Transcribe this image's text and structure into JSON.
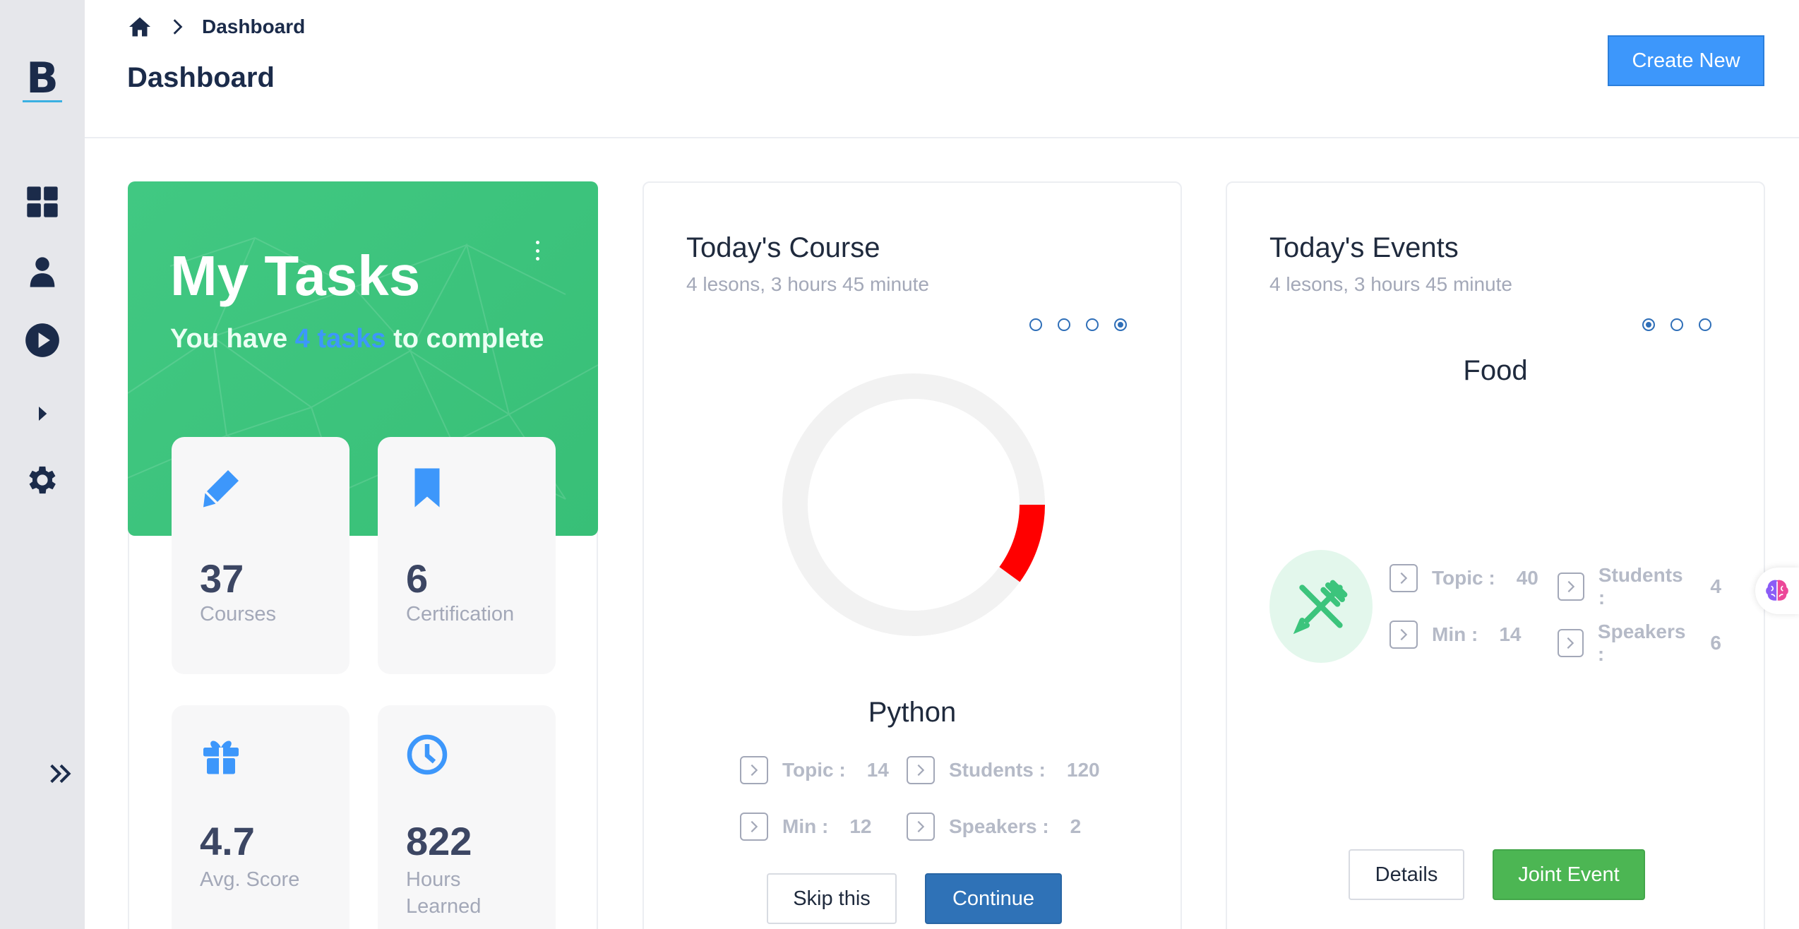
{
  "app": {
    "logo_text": "B"
  },
  "sidebar": {
    "items": [
      {
        "icon": "dashboard-grid-icon"
      },
      {
        "icon": "user-icon"
      },
      {
        "icon": "play-circle-icon"
      },
      {
        "icon": "caret-right-icon"
      },
      {
        "icon": "gear-icon"
      }
    ],
    "collapse_icon": "double-chevron-right-icon"
  },
  "header": {
    "breadcrumb": {
      "home_icon": "home-icon",
      "separator_icon": "chevron-right-icon",
      "current": "Dashboard"
    },
    "title": "Dashboard",
    "create_button": "Create New"
  },
  "tasks": {
    "title": "My Tasks",
    "subtitle_prefix": "You have ",
    "subtitle_highlight": "4 tasks",
    "subtitle_suffix": " to complete",
    "stats": [
      {
        "icon": "pen-icon",
        "value": "37",
        "label": "Courses"
      },
      {
        "icon": "bookmark-icon",
        "value": "6",
        "label": "Certification"
      },
      {
        "icon": "gift-icon",
        "value": "4.7",
        "label": "Avg. Score"
      },
      {
        "icon": "clock-icon",
        "value": "822",
        "label": "Hours Learned"
      }
    ]
  },
  "course": {
    "title": "Today's Course",
    "subtitle": "4 lesons, 3 hours 45 minute",
    "carousel": {
      "count": 4,
      "active_index": 3
    },
    "progress_fraction": 0.1,
    "progress_color": "#ff0000",
    "track_color": "#f2f2f2",
    "name": "Python",
    "meta": {
      "topic_label": "Topic :",
      "topic_value": "14",
      "students_label": "Students :",
      "students_value": "120",
      "min_label": "Min :",
      "min_value": "12",
      "speakers_label": "Speakers :",
      "speakers_value": "2"
    },
    "skip_button": "Skip this",
    "continue_button": "Continue"
  },
  "events": {
    "title": "Today's Events",
    "subtitle": "4 lesons, 3 hours 45 minute",
    "carousel": {
      "count": 3,
      "active_index": 0
    },
    "name": "Food",
    "icon": "fork-knife-icon",
    "meta": {
      "topic_label": "Topic :",
      "topic_value": "40",
      "students_label": "Students :",
      "students_value": "4",
      "min_label": "Min :",
      "min_value": "14",
      "speakers_label": "Speakers :",
      "speakers_value": "6"
    },
    "details_button": "Details",
    "join_button": "Joint Event"
  },
  "colors": {
    "brand_navy": "#1b2b4a",
    "primary_blue": "#3d97fb",
    "tasks_green": "#3cc47c",
    "continue_blue": "#2f72b7",
    "join_green": "#4cb653"
  },
  "floating": {
    "icon": "brain-icon"
  }
}
